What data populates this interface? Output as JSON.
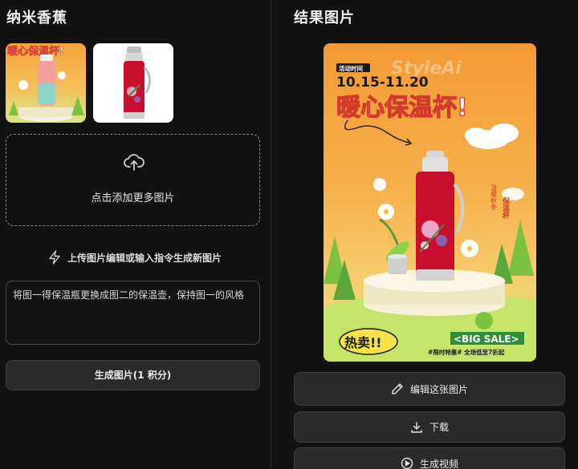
{
  "left_panel": {
    "title": "纳米香蕉",
    "upload": {
      "text": "点击添加更多图片"
    },
    "hint": "上传图片编辑或输入指令生成新图片",
    "prompt_value": "将图一得保温瓶更换成图二的保温壶，保持图一的风格",
    "generate_button": "生成图片(1 积分)"
  },
  "right_panel": {
    "title": "结果图片",
    "poster": {
      "watermark": "StyleAi",
      "event_tag": "活动时间",
      "dates": "10.15-11.20",
      "headline": "暖心保温杯!",
      "side_text_1": "温暖秋冬",
      "side_text_2": "保温杯",
      "badge": "热卖!!",
      "big_sale": "<BIG SALE>",
      "footer": "#限时特惠# 全场低至7折起"
    },
    "buttons": {
      "edit": "编辑这张图片",
      "download": "下载",
      "video": "生成视频"
    }
  },
  "colors": {
    "background": "#121212",
    "button_bg": "#2a2a2a",
    "poster_orange": "#f39a36",
    "poster_green": "#8cc63f",
    "flask_red": "#c8102e"
  }
}
